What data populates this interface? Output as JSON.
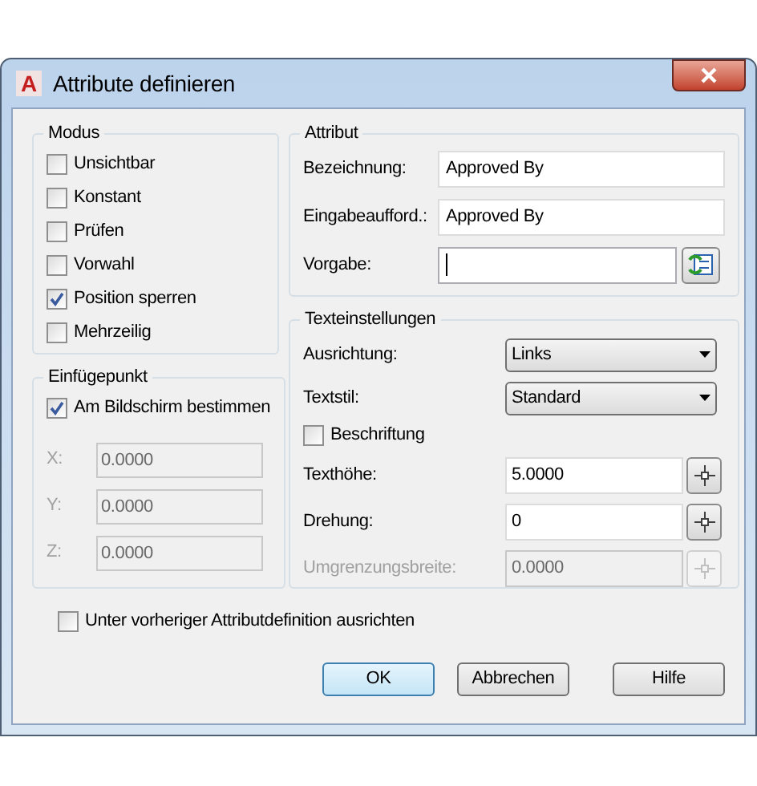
{
  "window": {
    "logo_letter": "A",
    "title": "Attribute definieren"
  },
  "modus": {
    "title": "Modus",
    "options": [
      {
        "label": "Unsichtbar",
        "checked": false
      },
      {
        "label": "Konstant",
        "checked": false
      },
      {
        "label": "Prüfen",
        "checked": false
      },
      {
        "label": "Vorwahl",
        "checked": false
      },
      {
        "label": "Position sperren",
        "checked": true
      },
      {
        "label": "Mehrzeilig",
        "checked": false
      }
    ]
  },
  "insertion_point": {
    "title": "Einfügepunkt",
    "on_screen": {
      "label": "Am Bildschirm bestimmen",
      "checked": true
    },
    "coords": [
      {
        "label": "X:",
        "value": "0.0000",
        "disabled": true
      },
      {
        "label": "Y:",
        "value": "0.0000",
        "disabled": true
      },
      {
        "label": "Z:",
        "value": "0.0000",
        "disabled": true
      }
    ]
  },
  "attribute": {
    "title": "Attribut",
    "fields": [
      {
        "kind": "text",
        "label": "Bezeichnung:",
        "value": "Approved By"
      },
      {
        "kind": "text",
        "label": "Eingabeaufford.:",
        "value": "Approved By"
      },
      {
        "kind": "insert_field",
        "label": "Vorgabe:"
      }
    ]
  },
  "text_settings": {
    "title": "Texteinstellungen",
    "rows": [
      {
        "kind": "dropdown",
        "label": "Ausrichtung:",
        "value": "Links"
      },
      {
        "kind": "dropdown",
        "label": "Textstil:",
        "value": "Standard"
      },
      {
        "kind": "checkbox",
        "label": "Beschriftung",
        "checked": false
      },
      {
        "kind": "pick",
        "label": "Texthöhe:",
        "value": "5.0000",
        "disabled": false
      },
      {
        "kind": "pick",
        "label": "Drehung:",
        "value": "0",
        "disabled": false
      },
      {
        "kind": "pick",
        "label": "Umgrenzungsbreite:",
        "value": "0.0000",
        "disabled": true
      }
    ]
  },
  "align_below": {
    "label": "Unter vorheriger Attributdefinition ausrichten",
    "checked": false
  },
  "buttons": [
    {
      "label": "OK",
      "default": true
    },
    {
      "label": "Abbrechen",
      "default": false
    },
    {
      "label": "Hilfe",
      "default": false
    }
  ]
}
